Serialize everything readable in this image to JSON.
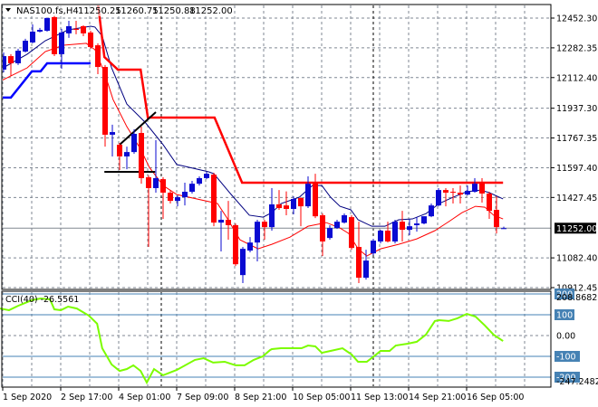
{
  "header": {
    "symbol": "NAS100.fs,H4",
    "open": "11250.25",
    "high": "11260.75",
    "low": "11250.88",
    "close": "11252.00"
  },
  "colors": {
    "bull": "#0a0ad2",
    "bear": "#ff0000",
    "ma_fast": "#000080",
    "ma_slow": "#ff0000",
    "stop_red": "#ff0000",
    "stop_blue": "#0000ff",
    "cci": "#7cfc00",
    "cci_level": "#4682b4",
    "grid": "#7f8793"
  },
  "chart_data": [
    {
      "type": "candlestick",
      "title": "NAS100.fs,H4",
      "ylim": [
        10912.45,
        12452.3
      ],
      "y_ticks": [
        "12452.30",
        "12282.35",
        "12112.40",
        "11937.30",
        "11767.35",
        "11597.40",
        "11427.45",
        "11082.40",
        "10912.45"
      ],
      "current_price_label": "11252.00",
      "current_price": 11252.0,
      "x_labels": [
        {
          "index": 0,
          "label": "1 Sep 2020"
        },
        {
          "index": 8,
          "label": "2 Sep 17:00"
        },
        {
          "index": 16,
          "label": "4 Sep 01:00"
        },
        {
          "index": 24,
          "label": "7 Sep 09:00"
        },
        {
          "index": 32,
          "label": "8 Sep 21:00"
        },
        {
          "index": 40,
          "label": "10 Sep 05:00"
        },
        {
          "index": 48,
          "label": "11 Sep 13:00"
        },
        {
          "index": 56,
          "label": "14 Sep 21:00"
        },
        {
          "index": 64,
          "label": "16 Sep 05:00"
        }
      ],
      "vlines": [
        21.75,
        51
      ],
      "ohlc": [
        [
          12158,
          12256,
          12142,
          12235
        ],
        [
          12235,
          12246,
          12122,
          12194
        ],
        [
          12194,
          12277,
          12184,
          12266
        ],
        [
          12261,
          12334,
          12256,
          12323
        ],
        [
          12313,
          12416,
          12308,
          12375
        ],
        [
          12375,
          12396,
          12370,
          12385
        ],
        [
          12380,
          12453,
          12375,
          12453
        ],
        [
          12458,
          12468,
          12235,
          12246
        ],
        [
          12246,
          12391,
          12163,
          12370
        ],
        [
          12365,
          12437,
          12339,
          12406
        ],
        [
          12391,
          12437,
          12360,
          12385
        ],
        [
          12406,
          12411,
          12349,
          12365
        ],
        [
          12370,
          12380,
          12277,
          12287
        ],
        [
          12297,
          12308,
          12132,
          12173
        ],
        [
          12173,
          12184,
          11718,
          11786
        ],
        [
          11786,
          11843,
          11662,
          11801
        ],
        [
          11729,
          11739,
          11584,
          11662
        ],
        [
          11662,
          11718,
          11589,
          11687
        ],
        [
          11687,
          11817,
          11677,
          11791
        ],
        [
          11796,
          11832,
          11506,
          11538
        ],
        [
          11543,
          11553,
          11145,
          11481
        ],
        [
          11481,
          11755,
          11455,
          11538
        ],
        [
          11532,
          11543,
          11305,
          11455
        ],
        [
          11455,
          11470,
          11393,
          11408
        ],
        [
          11408,
          11439,
          11377,
          11429
        ],
        [
          11429,
          11512,
          11382,
          11460
        ],
        [
          11460,
          11522,
          11450,
          11506
        ],
        [
          11506,
          11548,
          11496,
          11538
        ],
        [
          11538,
          11574,
          11532,
          11563
        ],
        [
          11558,
          11569,
          11263,
          11284
        ],
        [
          11284,
          11351,
          11119,
          11300
        ],
        [
          11300,
          11408,
          11186,
          11269
        ],
        [
          11269,
          11279,
          11036,
          11046
        ],
        [
          10984,
          11145,
          10938,
          11134
        ],
        [
          11124,
          11201,
          11114,
          11170
        ],
        [
          11170,
          11300,
          11062,
          11289
        ],
        [
          11289,
          11300,
          11186,
          11258
        ],
        [
          11258,
          11481,
          11238,
          11388
        ],
        [
          11388,
          11470,
          11357,
          11367
        ],
        [
          11382,
          11462,
          11326,
          11362
        ],
        [
          11362,
          11434,
          11331,
          11419
        ],
        [
          11424,
          11429,
          11263,
          11377
        ],
        [
          11377,
          11548,
          11367,
          11506
        ],
        [
          11512,
          11563,
          11310,
          11320
        ],
        [
          11326,
          11336,
          11093,
          11176
        ],
        [
          11196,
          11269,
          11186,
          11253
        ],
        [
          11253,
          11300,
          11248,
          11289
        ],
        [
          11284,
          11336,
          11279,
          11326
        ],
        [
          11315,
          11326,
          11129,
          11139
        ],
        [
          11145,
          11289,
          10938,
          10969
        ],
        [
          10969,
          11129,
          10958,
          11067
        ],
        [
          11108,
          11191,
          11098,
          11181
        ],
        [
          11176,
          11243,
          11165,
          11238
        ],
        [
          11238,
          11289,
          11170,
          11176
        ],
        [
          11176,
          11300,
          11165,
          11289
        ],
        [
          11289,
          11351,
          11176,
          11243
        ],
        [
          11243,
          11305,
          11212,
          11263
        ],
        [
          11269,
          11315,
          11232,
          11279
        ],
        [
          11279,
          11320,
          11274,
          11320
        ],
        [
          11320,
          11393,
          11315,
          11382
        ],
        [
          11382,
          11481,
          11377,
          11470
        ],
        [
          11470,
          11481,
          11377,
          11455
        ],
        [
          11460,
          11481,
          11393,
          11455
        ],
        [
          11455,
          11496,
          11393,
          11444
        ],
        [
          11444,
          11496,
          11439,
          11465
        ],
        [
          11460,
          11538,
          11455,
          11506
        ],
        [
          11512,
          11538,
          11398,
          11450
        ],
        [
          11450,
          11460,
          11305,
          11351
        ],
        [
          11357,
          11434,
          11222,
          11258
        ],
        [
          11250.25,
          11260.75,
          11250.25,
          11252.0
        ]
      ],
      "series": [
        {
          "name": "ma-fast",
          "points": [
            [
              -0.5,
              12158
            ],
            [
              3.25,
              12246
            ],
            [
              5.75,
              12323
            ],
            [
              8.9,
              12385
            ],
            [
              12,
              12406
            ],
            [
              12.6,
              12401
            ],
            [
              13.6,
              12349
            ],
            [
              14.9,
              12168
            ],
            [
              17,
              11961
            ],
            [
              19.5,
              11858
            ],
            [
              22,
              11729
            ],
            [
              23.9,
              11615
            ],
            [
              24.5,
              11610
            ],
            [
              28.3,
              11574
            ],
            [
              29,
              11563
            ],
            [
              31.4,
              11444
            ],
            [
              33.9,
              11326
            ],
            [
              35.8,
              11315
            ],
            [
              37,
              11341
            ],
            [
              38.3,
              11393
            ],
            [
              40.8,
              11429
            ],
            [
              42.6,
              11496
            ],
            [
              43.9,
              11496
            ],
            [
              45.1,
              11429
            ],
            [
              46.4,
              11377
            ],
            [
              47.9,
              11357
            ],
            [
              48.9,
              11300
            ],
            [
              50.8,
              11263
            ],
            [
              52.6,
              11263
            ],
            [
              54.5,
              11300
            ],
            [
              56.4,
              11305
            ],
            [
              58.3,
              11336
            ],
            [
              60.1,
              11393
            ],
            [
              62,
              11429
            ],
            [
              63.9,
              11460
            ],
            [
              65.8,
              11470
            ],
            [
              67,
              11455
            ],
            [
              68.9,
              11419
            ]
          ]
        },
        {
          "name": "ma-slow",
          "points": [
            [
              -0.5,
              12091
            ],
            [
              3.25,
              12168
            ],
            [
              5.75,
              12261
            ],
            [
              8.25,
              12297
            ],
            [
              11.4,
              12308
            ],
            [
              12.6,
              12272
            ],
            [
              13.9,
              12142
            ],
            [
              15.1,
              11987
            ],
            [
              17,
              11832
            ],
            [
              18.9,
              11703
            ],
            [
              20.1,
              11600
            ],
            [
              22,
              11496
            ],
            [
              23.9,
              11444
            ],
            [
              29.5,
              11393
            ],
            [
              30.75,
              11315
            ],
            [
              32.6,
              11186
            ],
            [
              35.1,
              11134
            ],
            [
              37,
              11160
            ],
            [
              39.5,
              11201
            ],
            [
              42,
              11263
            ],
            [
              44.5,
              11284
            ],
            [
              46.4,
              11253
            ],
            [
              47.6,
              11222
            ],
            [
              48.9,
              11134
            ],
            [
              50.1,
              11093
            ],
            [
              52,
              11134
            ],
            [
              54.5,
              11160
            ],
            [
              57,
              11191
            ],
            [
              59.5,
              11238
            ],
            [
              61.4,
              11289
            ],
            [
              63.25,
              11341
            ],
            [
              65.1,
              11377
            ],
            [
              66.4,
              11372
            ],
            [
              67.6,
              11326
            ],
            [
              68.9,
              11305
            ]
          ]
        },
        {
          "name": "stop-red",
          "points": [
            [
              13,
              12540
            ],
            [
              13.9,
              12230
            ],
            [
              15.75,
              12158
            ],
            [
              18.9,
              12158
            ],
            [
              19.9,
              11884
            ],
            [
              29.1,
              11884
            ],
            [
              32.9,
              11512
            ],
            [
              68.9,
              11512
            ]
          ]
        },
        {
          "name": "stop-blue",
          "points": [
            [
              -0.5,
              11998
            ],
            [
              1,
              11998
            ],
            [
              3.9,
              12148
            ],
            [
              5.1,
              12148
            ],
            [
              6,
              12194
            ],
            [
              12,
              12194
            ]
          ]
        }
      ],
      "trendlines": [
        {
          "name": "trendline-diagonal",
          "points": [
            [
              16,
              11729
            ],
            [
              21,
              11915
            ]
          ]
        },
        {
          "name": "trendline-horizontal",
          "points": [
            [
              13.9,
              11574
            ],
            [
              20.9,
              11574
            ]
          ]
        }
      ]
    },
    {
      "type": "line",
      "title": "CCI(40) -26.5561",
      "ylim": [
        -247.2482,
        208.8682
      ],
      "max_label": "208.8682",
      "min_label": "-247.2482",
      "levels": [
        {
          "value": 200,
          "label": "200",
          "boxed": true
        },
        {
          "value": 100,
          "label": "100",
          "boxed": true
        },
        {
          "value": 0,
          "label": "0.00",
          "boxed": false
        },
        {
          "value": -100,
          "label": "-100",
          "boxed": true
        },
        {
          "value": -200,
          "label": "-200",
          "boxed": true
        }
      ],
      "points": [
        [
          -0.5,
          130
        ],
        [
          0.75,
          122
        ],
        [
          2,
          143
        ],
        [
          3.9,
          170
        ],
        [
          5.1,
          178
        ],
        [
          6.4,
          174
        ],
        [
          7,
          126
        ],
        [
          7.9,
          122
        ],
        [
          8.9,
          139
        ],
        [
          10.1,
          130
        ],
        [
          11.75,
          96
        ],
        [
          12.9,
          57
        ],
        [
          13.6,
          -61
        ],
        [
          14.9,
          -139
        ],
        [
          16,
          -170
        ],
        [
          17,
          -161
        ],
        [
          17.9,
          -143
        ],
        [
          18.9,
          -170
        ],
        [
          19.75,
          -226
        ],
        [
          20.75,
          -161
        ],
        [
          22,
          -191
        ],
        [
          23.9,
          -165
        ],
        [
          26.4,
          -117
        ],
        [
          27.6,
          -109
        ],
        [
          28.9,
          -130
        ],
        [
          30.5,
          -126
        ],
        [
          32,
          -143
        ],
        [
          33.25,
          -143
        ],
        [
          34.5,
          -117
        ],
        [
          35.75,
          -100
        ],
        [
          36.75,
          -70
        ],
        [
          37,
          -65
        ],
        [
          38.25,
          -61
        ],
        [
          41.1,
          -61
        ],
        [
          42,
          -48
        ],
        [
          43,
          -52
        ],
        [
          43.9,
          -83
        ],
        [
          45.1,
          -74
        ],
        [
          46.75,
          -61
        ],
        [
          48,
          -91
        ],
        [
          48.9,
          -126
        ],
        [
          50.1,
          -126
        ],
        [
          51.4,
          -91
        ],
        [
          52,
          -74
        ],
        [
          53.25,
          -74
        ],
        [
          54.1,
          -48
        ],
        [
          55.75,
          -39
        ],
        [
          57,
          -30
        ],
        [
          58.25,
          4
        ],
        [
          59.5,
          70
        ],
        [
          60.1,
          74
        ],
        [
          61.4,
          70
        ],
        [
          62.6,
          83
        ],
        [
          63.9,
          104
        ],
        [
          65.1,
          91
        ],
        [
          66.4,
          48
        ],
        [
          67.6,
          4
        ],
        [
          68.9,
          -26.5561
        ]
      ]
    }
  ]
}
